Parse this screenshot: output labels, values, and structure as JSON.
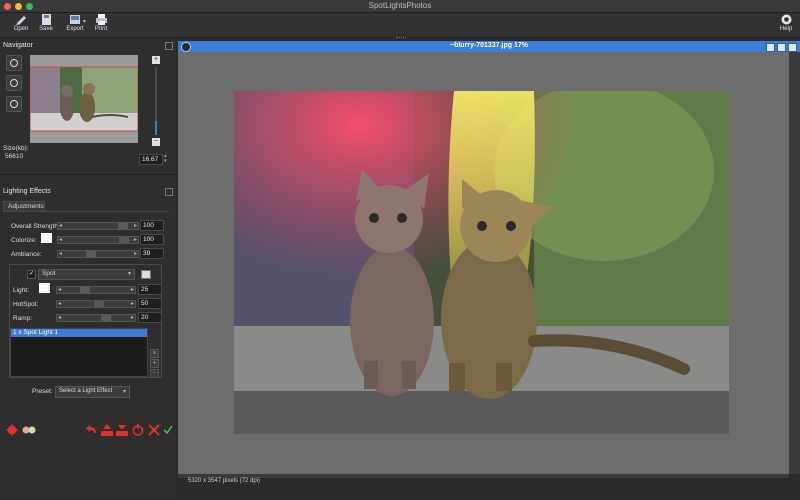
{
  "window": {
    "title": "SpotLightsPhotos"
  },
  "toolbar": {
    "open": "Open",
    "save": "Save",
    "export": "Export",
    "print": "Print",
    "help": "Help"
  },
  "navigator": {
    "title": "Navigator",
    "size_label": "Size(kb):",
    "size_value": "56610",
    "zoom_value": "16.67",
    "zoom_fraction": 0.2
  },
  "lighting": {
    "title": "Lighting Effects",
    "tab": "Adjustments",
    "overall_strength": {
      "label": "Overall Strength:",
      "value": "100",
      "level": 0.86
    },
    "colorize": {
      "label": "Colorize:",
      "value": "100",
      "level": 0.88,
      "color": "#ffffff"
    },
    "ambiance": {
      "label": "Ambiance:",
      "value": "39",
      "level": 0.33
    },
    "light_type": "Spot",
    "light_color": {
      "label": "Light:",
      "value": "25",
      "level": 0.25,
      "color": "#ffffff"
    },
    "hotspot": {
      "label": "HotSpot:",
      "value": "50",
      "level": 0.5
    },
    "ramp": {
      "label": "Ramp:",
      "value": "20",
      "level": 0.62
    },
    "light_list": [
      "1  x Spot Light 1"
    ],
    "preset_label": "Preset:",
    "preset_value": "Select a Light Effect"
  },
  "document": {
    "title": "~blurry-701337.jpg 17%",
    "status": "5320 x 3547 pixels (72 dpi)"
  },
  "colors": {
    "accent": "#3c7dd8",
    "red_icon": "#e03030",
    "green_icon": "#3cbf4c"
  }
}
